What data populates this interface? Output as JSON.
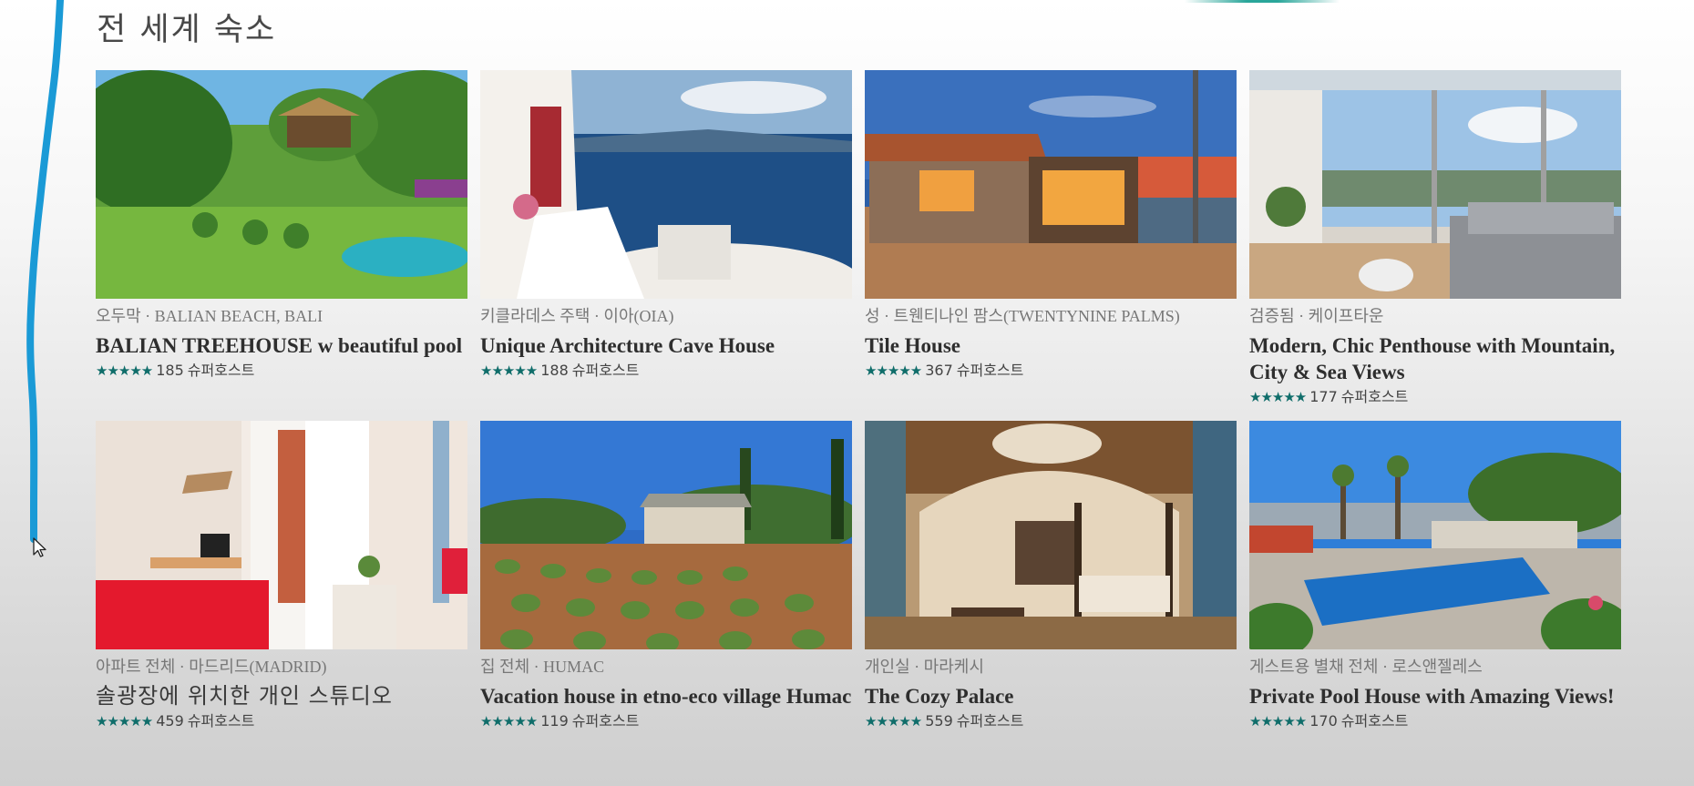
{
  "page": {
    "title": "전 세계 숙소"
  },
  "listings": [
    {
      "meta": "오두막 · BALIAN BEACH, BALI",
      "title": "BALIAN TREEHOUSE w beautiful pool",
      "stars": "★★★★★",
      "review_count": "185",
      "badge": "슈퍼호스트",
      "photo_icon": "treehouse-photo"
    },
    {
      "meta": "키클라데스 주택 · 이아(OIA)",
      "title": "Unique Architecture Cave House",
      "stars": "★★★★★",
      "review_count": "188",
      "badge": "슈퍼호스트",
      "photo_icon": "cave-house-photo"
    },
    {
      "meta": "성 · 트웬티나인 팜스(TWENTYNINE PALMS)",
      "title": "Tile House",
      "stars": "★★★★★",
      "review_count": "367",
      "badge": "슈퍼호스트",
      "photo_icon": "tile-house-photo"
    },
    {
      "meta": "검증됨 · 케이프타운",
      "title": "Modern, Chic Penthouse with Mountain, City & Sea Views",
      "stars": "★★★★★",
      "review_count": "177",
      "badge": "슈퍼호스트",
      "photo_icon": "penthouse-photo"
    },
    {
      "meta": "아파트 전체 · 마드리드(MADRID)",
      "title": "솔광장에 위치한 개인 스튜디오",
      "stars": "★★★★★",
      "review_count": "459",
      "badge": "슈퍼호스트",
      "photo_icon": "studio-photo"
    },
    {
      "meta": "집 전체 · HUMAC",
      "title": "Vacation house in etno-eco village Humac",
      "stars": "★★★★★",
      "review_count": "119",
      "badge": "슈퍼호스트",
      "photo_icon": "village-house-photo"
    },
    {
      "meta": "개인실 · 마라케시",
      "title": "The Cozy Palace",
      "stars": "★★★★★",
      "review_count": "559",
      "badge": "슈퍼호스트",
      "photo_icon": "palace-photo"
    },
    {
      "meta": "게스트용 별채 전체 · 로스앤젤레스",
      "title": "Private Pool House with Amazing Views!",
      "stars": "★★★★★",
      "review_count": "170",
      "badge": "슈퍼호스트",
      "photo_icon": "pool-house-photo"
    }
  ],
  "colors": {
    "star": "#0f6d6a",
    "annotation_stroke": "#1a9ad6",
    "title_text": "#2e2e2e",
    "meta_text": "#777777"
  }
}
